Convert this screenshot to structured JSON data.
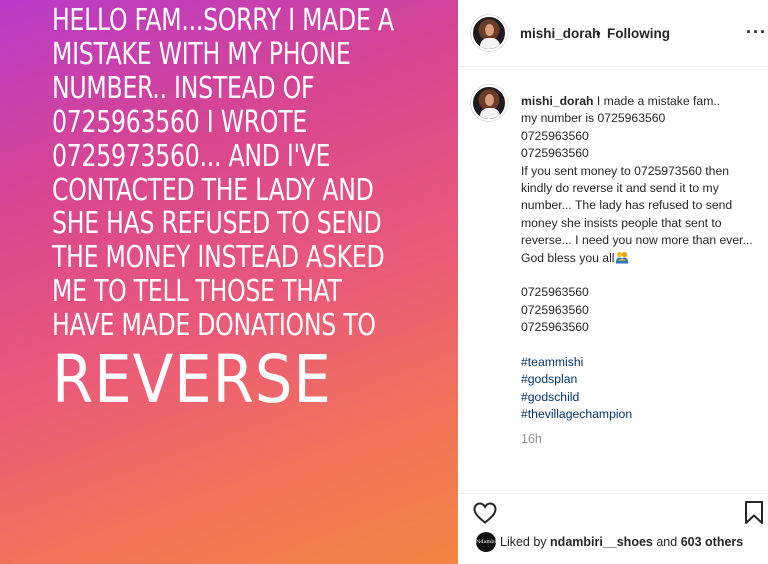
{
  "story": {
    "lines": [
      "HELLO FAM...SORRY I MADE A",
      "MISTAKE WITH MY PHONE",
      "NUMBER.. INSTEAD OF",
      "0725963560 I WROTE",
      "0725973560... AND I'VE",
      "CONTACTED THE LADY AND",
      "SHE HAS REFUSED TO SEND",
      "THE MONEY INSTEAD ASKED",
      "ME TO TELL THOSE THAT",
      "HAVE MADE DONATIONS TO"
    ],
    "big_word": "REVERSE"
  },
  "header": {
    "username": "mishi_dorah",
    "separator": "•",
    "follow_state": "Following",
    "more_label": "···"
  },
  "caption": {
    "username": "mishi_dorah",
    "first_text": "I made a mistake fam..",
    "lines_a": [
      "my number is 0725963560",
      "0725963560",
      "0725963560"
    ],
    "paragraph": "If you sent money to 0725973560 then kindly do reverse it and send it to my number... The lady has refused to send money she insists people that sent to reverse... I need you now more than ever... God bless you all",
    "numbers": [
      "0725963560",
      "0725963560",
      "0725963560"
    ],
    "hashtags": [
      "#teammishi",
      "#godsplan",
      "#godschild",
      "#thevillagechampion"
    ],
    "time": "16h"
  },
  "likes": {
    "prefix": "Liked by",
    "user": "ndambiri__shoes",
    "connector": "and",
    "others": "603 others",
    "liker_avatar_text": "Ndambiri"
  },
  "icons": {
    "heart": "heart-icon",
    "bookmark": "bookmark-icon",
    "more": "more-icon",
    "hug": "people-hugging-icon"
  },
  "colors": {
    "hashtag": "#003569",
    "muted": "#8e8e8e",
    "text": "#262626"
  }
}
